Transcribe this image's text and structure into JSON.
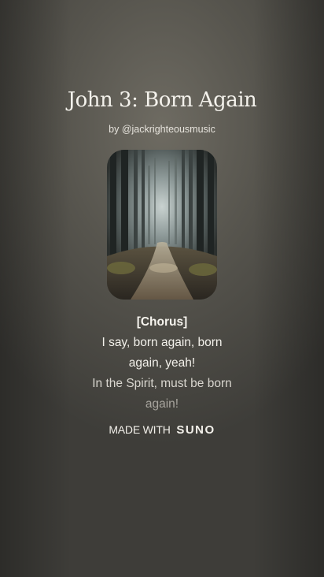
{
  "song": {
    "title": "John 3: Born Again",
    "byline": "by @jackrighteousmusic"
  },
  "lyrics": {
    "section": "[Chorus]",
    "line1": "I say, born again, born",
    "line2": "again, yeah!",
    "line3": "In the Spirit, must be born",
    "line4": "again!"
  },
  "footer": {
    "made_with": "MADE WITH",
    "brand": "SUNO"
  },
  "cover_art": {
    "icon": "forest-path-artwork"
  }
}
